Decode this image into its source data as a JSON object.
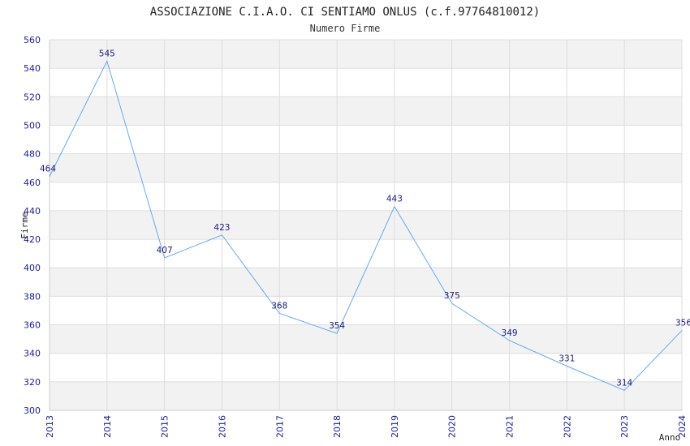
{
  "chart_data": {
    "type": "line",
    "title": "ASSOCIAZIONE C.I.A.O. CI SENTIAMO ONLUS (c.f.97764810012)",
    "subtitle": "Numero Firme",
    "xlabel": "Anno",
    "ylabel": "Firme",
    "x": [
      "2013",
      "2014",
      "2015",
      "2016",
      "2017",
      "2018",
      "2019",
      "2020",
      "2021",
      "2022",
      "2023",
      "2024"
    ],
    "values": [
      464,
      545,
      407,
      423,
      368,
      354,
      443,
      375,
      349,
      331,
      314,
      356
    ],
    "ylim": [
      300,
      560
    ],
    "yticks": [
      300,
      320,
      340,
      360,
      380,
      400,
      420,
      440,
      460,
      480,
      500,
      520,
      540,
      560
    ],
    "grid": true,
    "colors": {
      "line": "#66aaee",
      "band": "#f2f2f2",
      "grid": "#dddddd",
      "tick_text": "#1a1aa6",
      "label_text": "#1a1a80"
    }
  }
}
